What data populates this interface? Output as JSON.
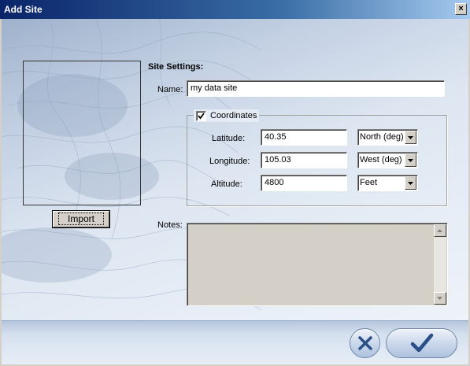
{
  "window": {
    "title": "Add Site",
    "close_glyph": "×"
  },
  "preview": {
    "import_label": "Import"
  },
  "settings": {
    "heading": "Site Settings:",
    "name_label": "Name:",
    "name_value": "my data site",
    "coordinates_label": "Coordinates",
    "coordinates_checked": true,
    "latitude_label": "Latitude:",
    "latitude_value": "40.35",
    "latitude_dir": "North (deg)",
    "longitude_label": "Longitude:",
    "longitude_value": "105.03",
    "longitude_dir": "West (deg)",
    "altitude_label": "Altitude:",
    "altitude_value": "4800",
    "altitude_unit": "Feet",
    "notes_label": "Notes:",
    "notes_value": ""
  },
  "footer": {
    "cancel_icon": "x-icon",
    "ok_icon": "checkmark-icon"
  },
  "colors": {
    "title_start": "#0a246a",
    "title_end": "#a6caf0",
    "accent": "#2a4f86"
  }
}
